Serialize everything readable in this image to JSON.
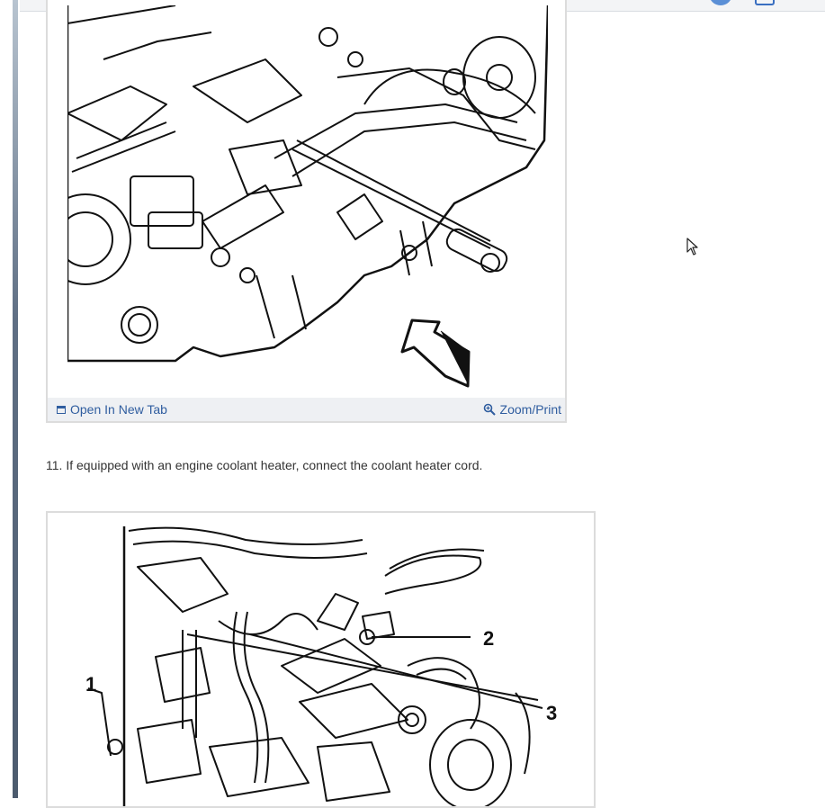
{
  "figures": [
    {
      "image_alt": "Engine assembly diagram with arrow",
      "footer": {
        "open_tab_label": "Open In New Tab",
        "zoom_label": "Zoom/Print"
      }
    },
    {
      "image_alt": "Engine coolant heater cord diagram",
      "callouts": [
        "1",
        "2",
        "3"
      ]
    }
  ],
  "step": {
    "text": "11. If equipped with an engine coolant heater, connect the coolant heater cord."
  },
  "icons": {
    "open_tab": "open-new-tab-icon",
    "zoom": "magnifier-icon",
    "cursor": "mouse-pointer-icon"
  },
  "colors": {
    "link": "#2f5d9f",
    "footer_bg": "#eef0f3",
    "text": "#333333"
  }
}
